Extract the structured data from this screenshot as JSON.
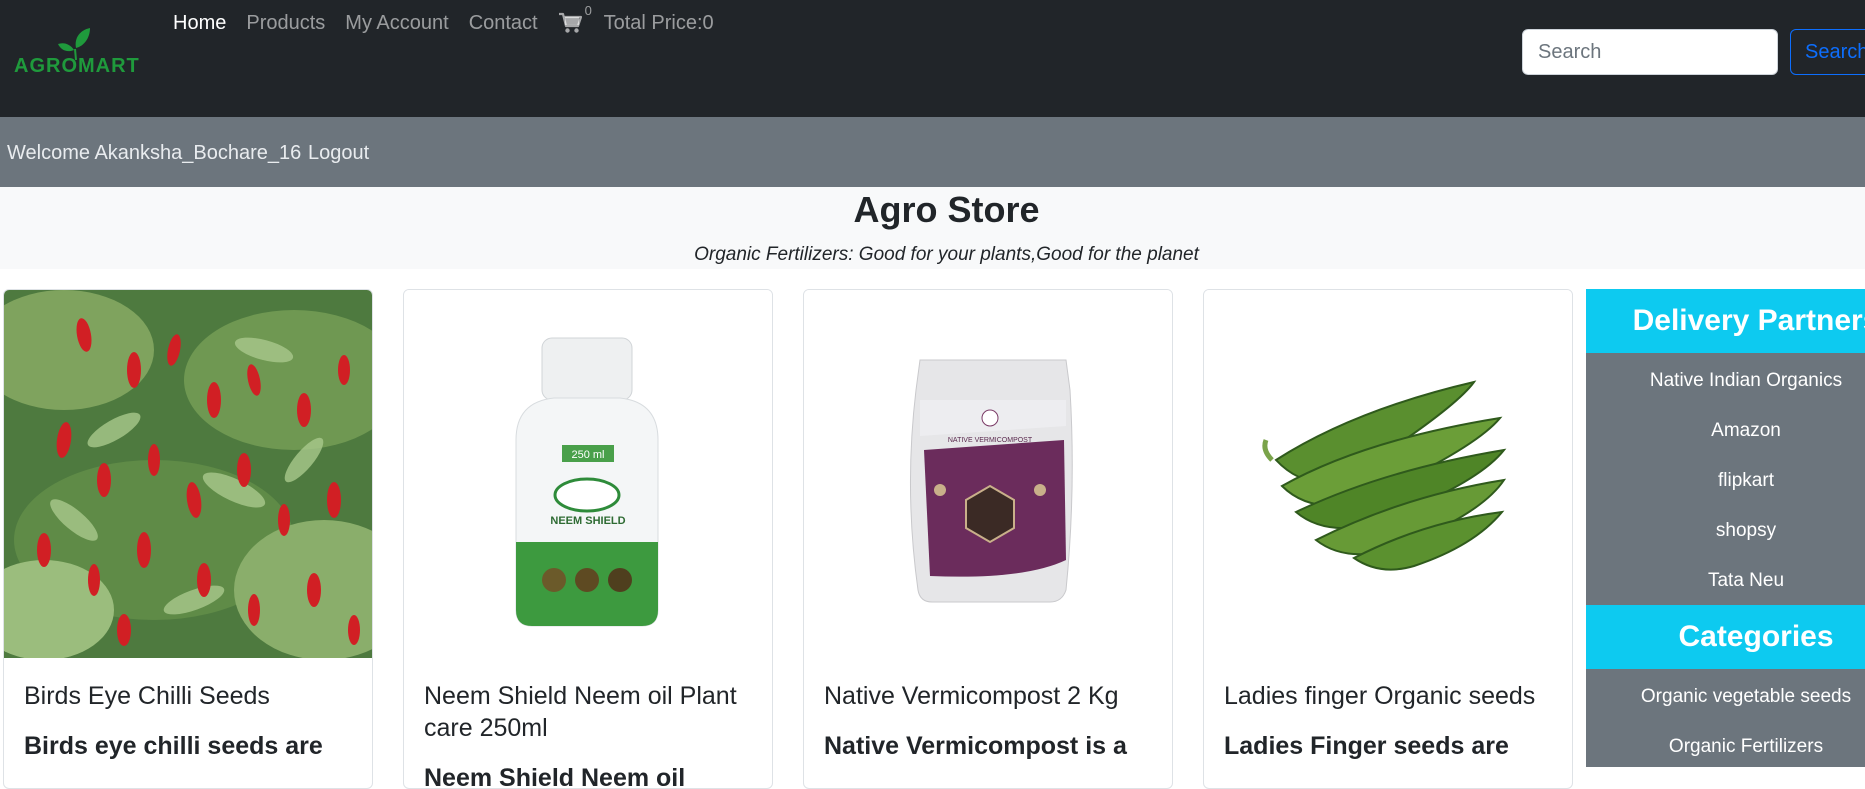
{
  "brand": {
    "logo_text": "AGROMART"
  },
  "nav": {
    "home": "Home",
    "products": "Products",
    "account": "My Account",
    "contact": "Contact",
    "cart_count": "0",
    "total_price": "Total Price:0"
  },
  "search": {
    "placeholder": "Search",
    "button_label": "Search"
  },
  "user_bar": {
    "welcome": "Welcome Akanksha_Bochare_16",
    "logout": "Logout"
  },
  "hero": {
    "title": "Agro Store",
    "subtitle": "Organic Fertilizers: Good for your plants,Good for the planet"
  },
  "products": [
    {
      "title": "Birds Eye Chilli Seeds",
      "text": "Birds eye chilli seeds are"
    },
    {
      "title": "Neem Shield Neem oil Plant care 250ml",
      "text": "Neem Shield Neem oil"
    },
    {
      "title": "Native Vermicompost 2 Kg",
      "text": "Native Vermicompost is a"
    },
    {
      "title": "Ladies finger Organic seeds",
      "text": "Ladies Finger seeds are"
    }
  ],
  "product_labels": {
    "bottle_volume": "250 ml",
    "bottle_name": "NEEM SHIELD",
    "pouch_name": "NATIVE VERMICOMPOST"
  },
  "sidebar": {
    "delivery_heading": "Delivery Partners",
    "delivery_partners": [
      "Native Indian Organics",
      "Amazon",
      "flipkart",
      "shopsy",
      "Tata Neu"
    ],
    "categories_heading": "Categories",
    "categories": [
      "Organic vegetable seeds",
      "Organic Fertilizers"
    ]
  },
  "colors": {
    "navbar": "#212529",
    "subbar": "#6c757d",
    "accent_cyan": "#0dcaf0",
    "link_blue": "#0d6efd",
    "brand_green": "#1f9a3c"
  },
  "icons": [
    "leaf-logo-icon",
    "cart-icon"
  ]
}
